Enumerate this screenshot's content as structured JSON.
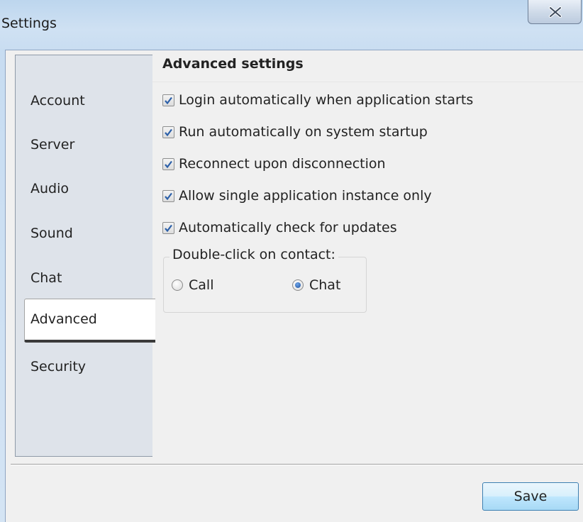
{
  "window": {
    "title": "Settings",
    "close_icon": "close-x-icon"
  },
  "sidebar": {
    "items": [
      {
        "label": "Account",
        "active": false
      },
      {
        "label": "Server",
        "active": false
      },
      {
        "label": "Audio",
        "active": false
      },
      {
        "label": "Sound",
        "active": false
      },
      {
        "label": "Chat",
        "active": false
      },
      {
        "label": "Advanced",
        "active": true
      },
      {
        "label": "Security",
        "active": false
      }
    ]
  },
  "main": {
    "title": "Advanced settings",
    "options": [
      {
        "label": "Login automatically when application starts",
        "checked": true
      },
      {
        "label": "Run automatically on system startup",
        "checked": true
      },
      {
        "label": "Reconnect upon disconnection",
        "checked": true
      },
      {
        "label": "Allow single application instance only",
        "checked": true
      },
      {
        "label": "Automatically check for updates",
        "checked": true
      }
    ],
    "double_click": {
      "legend": "Double-click on contact:",
      "options": [
        {
          "label": "Call",
          "selected": false
        },
        {
          "label": "Chat",
          "selected": true
        }
      ]
    }
  },
  "footer": {
    "save_label": "Save"
  },
  "colors": {
    "titlebar": "#c9ddf1",
    "sidebar_bg": "#dee3ea",
    "button_border": "#3c7fb1",
    "check_mark": "#2b5fa8"
  }
}
